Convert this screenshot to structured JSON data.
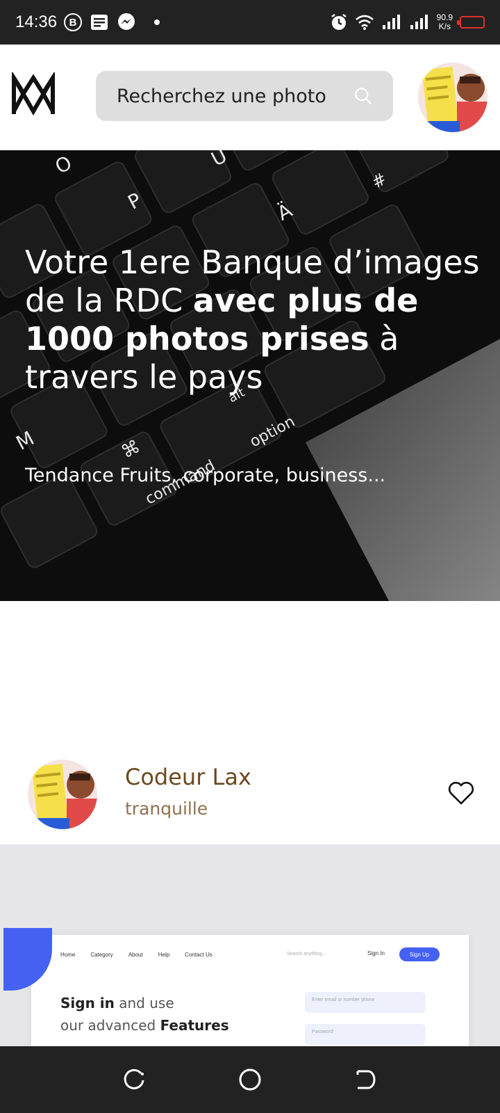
{
  "status_bar": {
    "time": "14:36",
    "badge_letter": "B",
    "net_speed_value": "90.9",
    "net_speed_unit": "K/s",
    "icons": [
      "b-circle-icon",
      "notes-icon",
      "messenger-icon",
      "dot-icon",
      "alarm-icon",
      "wifi-icon",
      "signal-icon",
      "signal-icon-2",
      "battery-icon"
    ]
  },
  "header": {
    "search_placeholder": "Recherchez une photo"
  },
  "hero": {
    "line_normal_1": "Votre 1ere Banque d’images de la RDC ",
    "line_bold": "avec plus de 1000 photos prises",
    "line_normal_2": " à travers le pays",
    "trending": "Tendance Fruits, corporate, business...",
    "keyboard_keys": [
      "O",
      "P",
      "Ü",
      "Ä",
      "#",
      "M",
      "option",
      "alt",
      "command",
      "⌘"
    ]
  },
  "card": {
    "author_name": "Codeur Lax",
    "author_subtitle": "tranquille"
  },
  "preview": {
    "nav_items": [
      "Home",
      "Category",
      "About",
      "Help",
      "Contact Us"
    ],
    "search_text": "Search anything...",
    "signin_label": "Sign In",
    "signup_label": "Sign Up",
    "headline_bold_1": "Sign in",
    "headline_light_1": " and use",
    "headline_light_2": "our advanced ",
    "headline_bold_2": "Features",
    "field_1": "Enter email or number phone",
    "field_2": "Password"
  },
  "colors": {
    "status_bg": "#222222",
    "search_bg": "#dedede",
    "author_name": "#6b4a1f",
    "author_sub": "#8d7250",
    "accent_blue": "#4461f2",
    "battery_red": "#e0302a"
  }
}
